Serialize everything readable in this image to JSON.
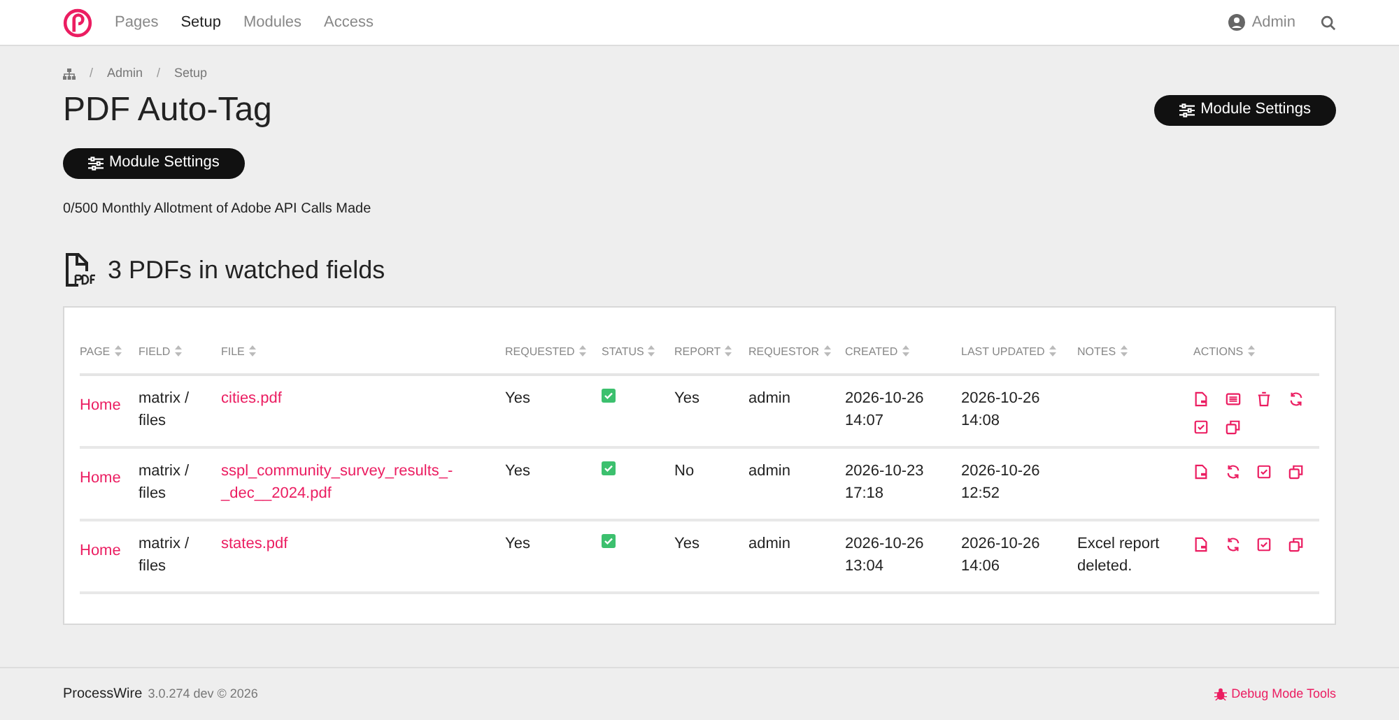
{
  "nav": {
    "items": [
      {
        "label": "Pages",
        "selected": false
      },
      {
        "label": "Setup",
        "selected": true
      },
      {
        "label": "Modules",
        "selected": false
      },
      {
        "label": "Access",
        "selected": false
      }
    ],
    "user": "Admin"
  },
  "breadcrumbs": [
    {
      "separator": "/",
      "label": "Admin"
    },
    {
      "separator": "/",
      "label": "Setup"
    }
  ],
  "title": "PDF Auto-Tag",
  "header_button": "Module Settings",
  "settings_button": "Module Settings",
  "allotment": "0/500 Monthly Allotment of Adobe API Calls Made",
  "section_title": "3 PDFs in watched fields",
  "table": {
    "columns": [
      "PAGE",
      "FIELD",
      "FILE",
      "REQUESTED",
      "STATUS",
      "REPORT",
      "REQUESTOR",
      "CREATED",
      "LAST UPDATED",
      "NOTES",
      "ACTIONS"
    ],
    "rows": [
      {
        "page": "Home",
        "field": "matrix / files",
        "file": "cities.pdf",
        "requested": "Yes",
        "status_ok": true,
        "report": "Yes",
        "requestor": "admin",
        "created": "2026-10-26 14:07",
        "updated": "2026-10-26 14:08",
        "actions": [
          {
            "kind": "pdf"
          },
          {
            "kind": "report"
          },
          {
            "kind": "delete"
          },
          {
            "kind": "refresh"
          },
          {
            "kind": "check"
          },
          {
            "kind": "copy"
          }
        ]
      },
      {
        "page": "Home",
        "field": "matrix / files",
        "file": "sspl_community_survey_results_-_dec__2024.pdf",
        "requested": "Yes",
        "status_ok": true,
        "report": "No",
        "requestor": "admin",
        "created": "2026-10-23 17:18",
        "updated": "2026-10-26 12:52",
        "actions": [
          {
            "kind": "pdf"
          },
          {
            "kind": "refresh"
          },
          {
            "kind": "check"
          },
          {
            "kind": "copy"
          }
        ]
      },
      {
        "page": "Home",
        "field": "matrix / files",
        "file": "states.pdf",
        "requested": "Yes",
        "status_ok": true,
        "report": "Yes",
        "requestor": "admin",
        "created": "2026-10-26 13:04",
        "updated": "2026-10-26 14:06",
        "notes": "Excel report deleted.",
        "actions": [
          {
            "kind": "pdf"
          },
          {
            "kind": "refresh"
          },
          {
            "kind": "check"
          },
          {
            "kind": "copy"
          }
        ]
      }
    ]
  },
  "footer": {
    "brand": "ProcessWire",
    "version": "3.0.274 dev © 2026",
    "debug": "Debug Mode Tools"
  }
}
